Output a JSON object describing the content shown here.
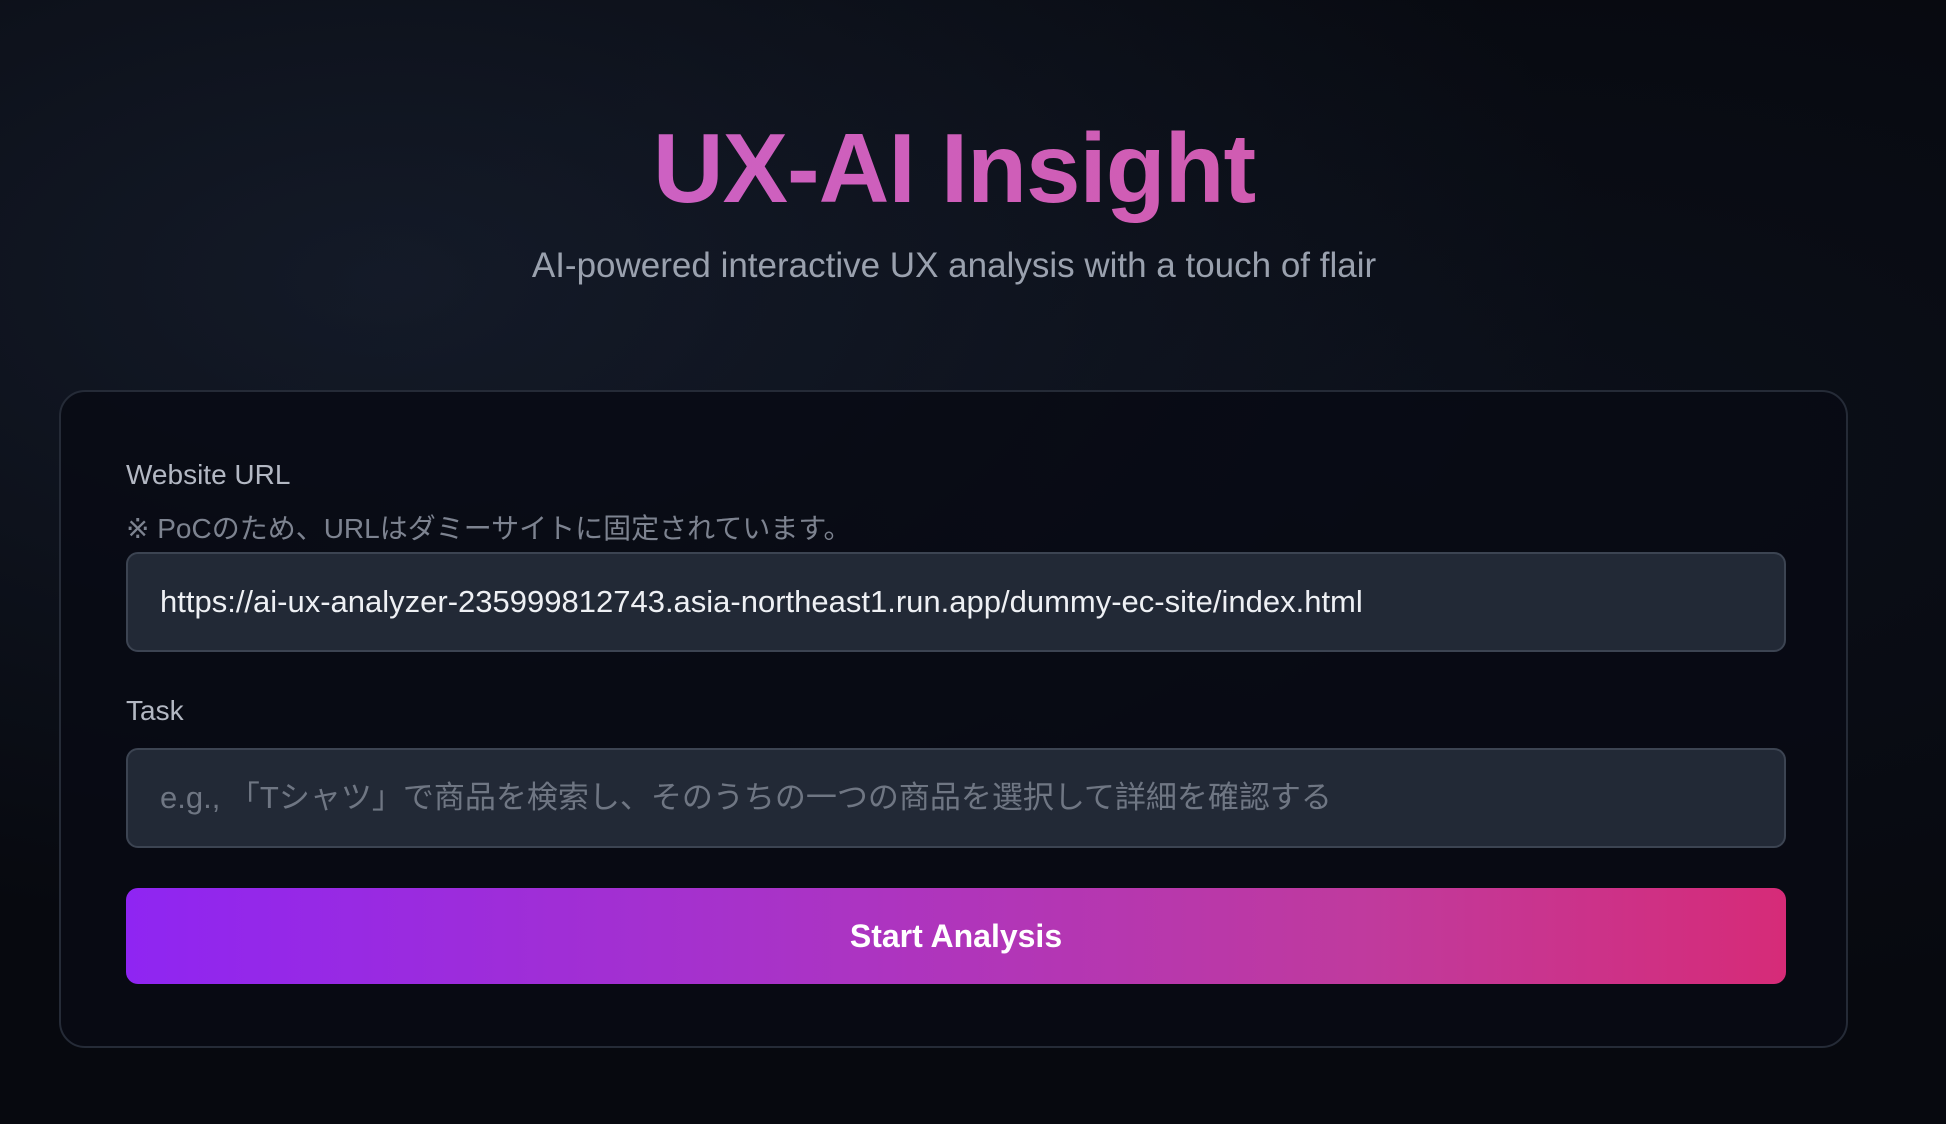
{
  "header": {
    "title": "UX-AI Insight",
    "subtitle": "AI-powered interactive UX analysis with a touch of flair"
  },
  "form": {
    "url_label": "Website URL",
    "url_note": "※ PoCのため、URLはダミーサイトに固定されています。",
    "url_value": "https://ai-ux-analyzer-235999812743.asia-northeast1.run.app/dummy-ec-site/index.html",
    "task_label": "Task",
    "task_placeholder": "e.g., 「Tシャツ」で商品を検索し、そのうちの一つの商品を選択して詳細を確認する",
    "submit_label": "Start Analysis"
  },
  "colors": {
    "background": "#07090f",
    "title_gradient_start": "#c966d4",
    "title_gradient_end": "#d4579f",
    "button_gradient_start": "#8f25f2",
    "button_gradient_end": "#d62b78",
    "input_background": "#222936"
  }
}
